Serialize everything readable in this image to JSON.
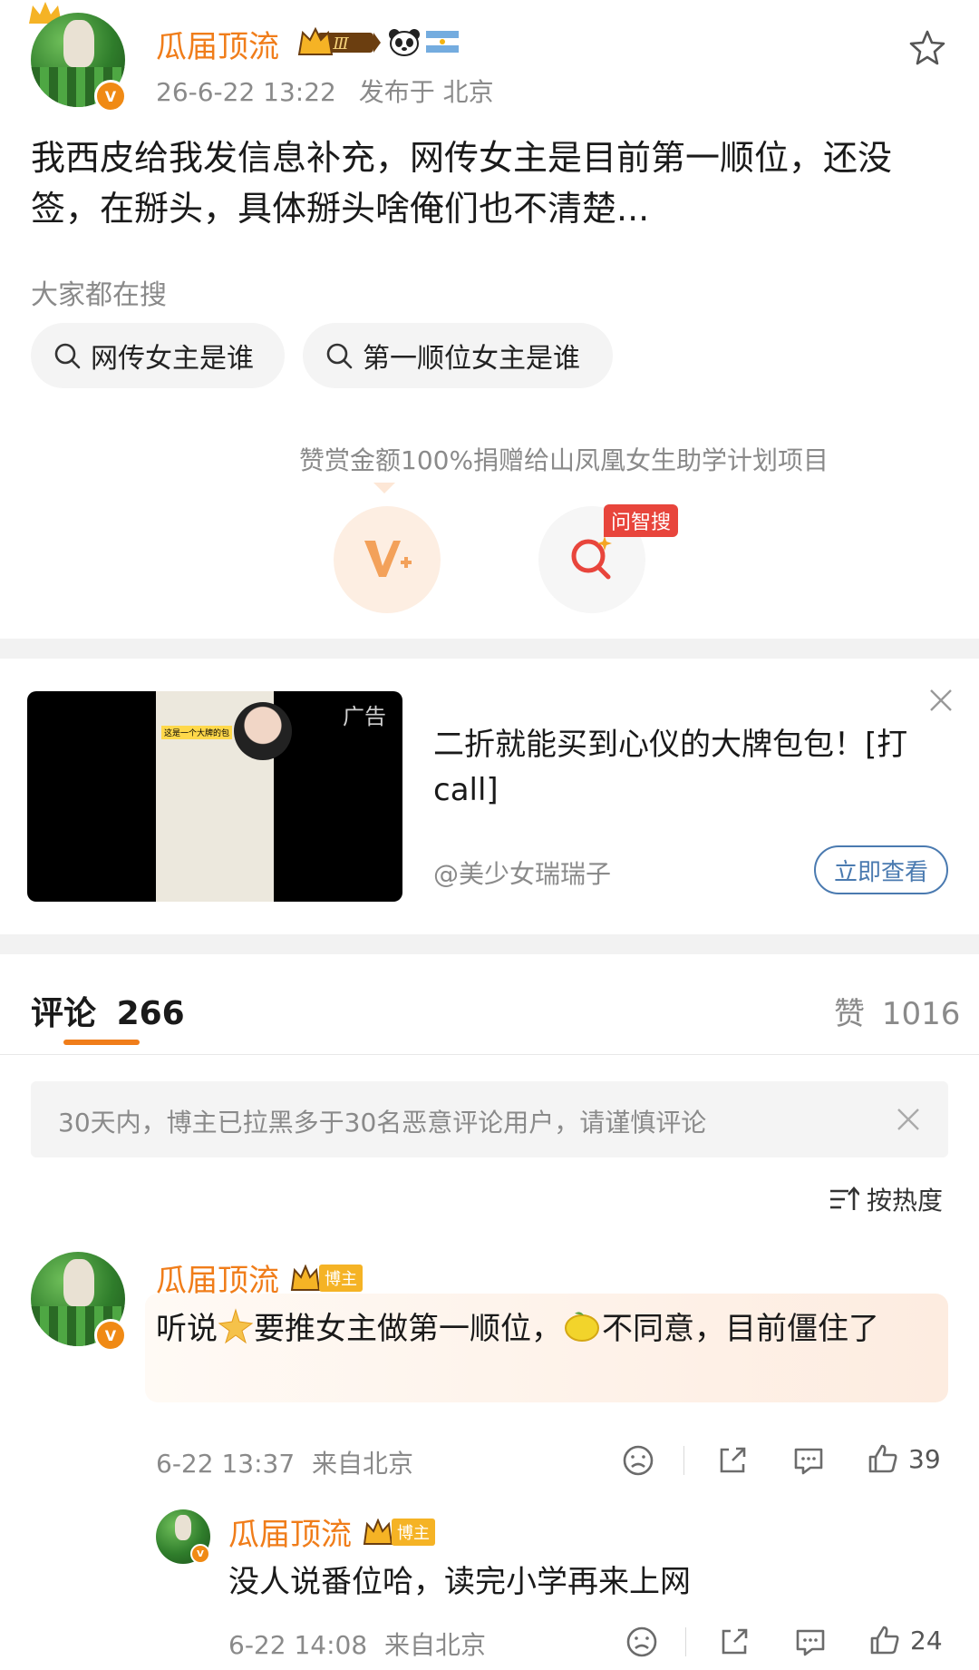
{
  "post": {
    "username": "瓜届顶流",
    "timestamp": "26-6-22 13:22",
    "location": "发布于 北京",
    "text": "我西皮给我发信息补充，网传女主是目前第一顺位，还没签，在掰头，具体掰头啥俺们也不清楚...",
    "level_badge": "Ⅲ"
  },
  "search_section": {
    "title": "大家都在搜",
    "chips": [
      "网传女主是谁",
      "第一顺位女主是谁"
    ]
  },
  "reward": {
    "text": "赞赏金额100%捐赠给山凤凰女生助学计划项目",
    "zhisou_tag": "问智搜"
  },
  "ad": {
    "tag": "广告",
    "title": "二折就能买到心仪的大牌包包！[打call]",
    "account": "@美少女瑞瑞子",
    "button": "立即查看",
    "video_caption": "这是一个大牌的包"
  },
  "comments_header": {
    "tab_label": "评论",
    "count": "266",
    "likes_label": "赞",
    "likes_count": "1016"
  },
  "notice": {
    "text": "30天内，博主已拉黑多于30名恶意评论用户，请谨慎评论"
  },
  "sort": {
    "label": "按热度"
  },
  "comments": [
    {
      "username": "瓜届顶流",
      "badge": "博主",
      "text_before": "听说",
      "text_middle": "要推女主做第一顺位，",
      "text_after": "不同意，目前僵住了",
      "time": "6-22 13:37",
      "location": "来自北京",
      "likes": "39"
    },
    {
      "username": "瓜届顶流",
      "badge": "博主",
      "text": "没人说番位哈，读完小学再来上网",
      "time": "6-22 14:08",
      "location": "来自北京",
      "likes": "24"
    }
  ],
  "colors": {
    "accent": "#f07d1a",
    "link_blue": "#4a7ab0",
    "zhisou_red": "#e8453c"
  },
  "icons": [
    "crown-icon",
    "panda-icon",
    "argentina-flag-icon",
    "star-icon",
    "search-icon",
    "vplus-icon",
    "zhisou-icon",
    "close-icon",
    "sort-icon",
    "dislike-icon",
    "share-icon",
    "comment-icon",
    "like-icon"
  ]
}
